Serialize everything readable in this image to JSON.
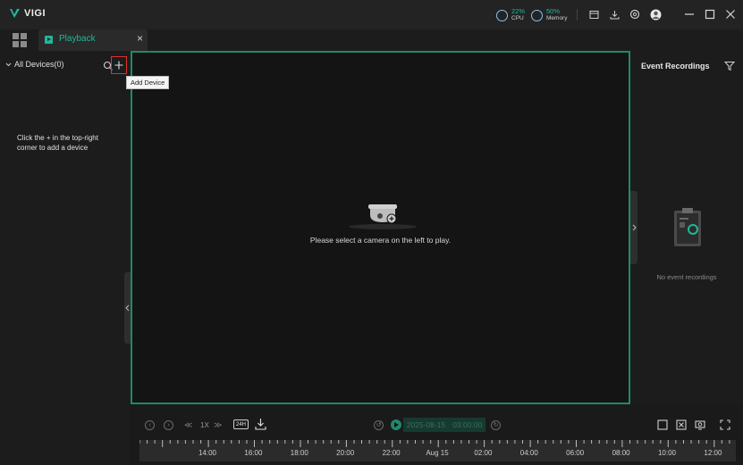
{
  "app": {
    "name": "VIGI"
  },
  "stats": {
    "cpu": {
      "value": "22%",
      "label": "CPU"
    },
    "memory": {
      "value": "50%",
      "label": "Memory"
    }
  },
  "tab": {
    "label": "Playback",
    "close": "×"
  },
  "left_panel": {
    "all_devices": "All Devices(0)",
    "add_device_tooltip": "Add Device",
    "hint": "Click the + in the top-right corner to add a device"
  },
  "video": {
    "message": "Please select a camera on the left to play."
  },
  "right_panel": {
    "title": "Event Recordings",
    "empty": "No event recordings"
  },
  "controls": {
    "speed": "1X",
    "mode_24h": "24H",
    "date": "2025-08-15",
    "time": "03:00:00"
  },
  "timeline": {
    "labels": [
      "14:00",
      "16:00",
      "18:00",
      "20:00",
      "22:00",
      "Aug 15",
      "02:00",
      "04:00",
      "06:00",
      "08:00",
      "10:00",
      "12:00"
    ]
  },
  "colors": {
    "accent": "#1fb89a",
    "border_green": "#1e8a6c"
  }
}
